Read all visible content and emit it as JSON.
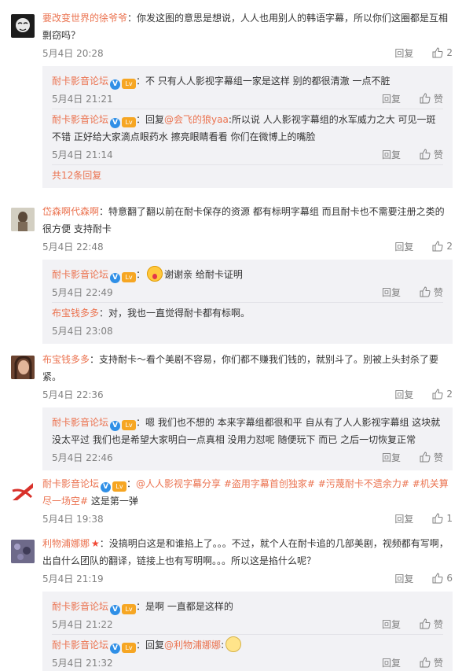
{
  "actions": {
    "reply_label": "回复",
    "like_label": "赞"
  },
  "threads": [
    {
      "user": "要改变世界的徐爷爷",
      "text": "你发这图的意思是想说，人人也用别人的韩语字幕，所以你们这圈都是互相剽窃吗？",
      "time": "5月4日 20:28",
      "likes": "2",
      "avatar_color": "#1c1c1c",
      "replies": [
        {
          "user": "耐卡影音论坛",
          "text": "不 只有人人影视字幕组一家是这样 别的都很清澈 一点不脏",
          "time": "5月4日 21:21"
        },
        {
          "user": "耐卡影音论坛",
          "prefix": "回复",
          "mention": "@会飞的狼yaa",
          "text": "所以说 人人影视字幕组的水军威力之大 可见一斑 不错 正好给大家滴点眼药水 擦亮眼睛看看 你们在微博上的嘴脸",
          "time": "5月4日 21:14"
        }
      ],
      "more": "共12条回复"
    },
    {
      "user": "岱森啊代森啊",
      "text": "特意翻了翻以前在耐卡保存的资源 都有标明字幕组 而且耐卡也不需要注册之类的很方便 支持耐卡",
      "time": "5月4日 22:48",
      "likes": "2",
      "avatar_color": "#b9b6a8",
      "replies": [
        {
          "user": "耐卡影音论坛",
          "text": "谢谢亲 给耐卡证明",
          "time": "5月4日 22:49"
        },
        {
          "user": "布宝钱多多",
          "text": "对，我也一直觉得耐卡都有标啊。",
          "time": "5月4日 23:08"
        }
      ]
    },
    {
      "user": "布宝钱多多",
      "text": "支持耐卡～看个美剧不容易，你们都不赚我们钱的，就别斗了。别被上头封杀了要紧。",
      "time": "5月4日 22:36",
      "likes": "2",
      "avatar_color": "#8a5a3c",
      "replies": [
        {
          "user": "耐卡影音论坛",
          "text": "嗯 我们也不想的 本来字幕组都很和平 自从有了人人影视字幕组 这块就没太平过 我们也是希望大家明白一点真相 没用力怼呢 随便玩下 而已 之后一切恢复正常",
          "time": "5月4日 22:46"
        }
      ]
    },
    {
      "user": "耐卡影音论坛",
      "text_parts": [
        "@人人影视字幕分享",
        " #盗用字幕首创独家#",
        " #污蔑耐卡不遗余力#",
        " #机关算尽一场空#",
        " 这是第一弹"
      ],
      "time": "5月4日 19:38",
      "likes": "1",
      "avatar_color": "#d8312a"
    },
    {
      "user": "利物浦娜娜",
      "text": "没搞明白这是和谁掐上了。。。不过，就个人在耐卡追的几部美剧，视频都有写啊，出自什么团队的翻译，链接上也有写明啊。。。所以这是掐什么呢？",
      "time": "5月4日 21:19",
      "likes": "6",
      "avatar_color": "#5a5a7a",
      "replies": [
        {
          "user": "耐卡影音论坛",
          "text": "是啊 一直都是这样的",
          "time": "5月4日 21:22"
        },
        {
          "user": "耐卡影音论坛",
          "prefix": "回复",
          "mention": "@利物浦娜娜",
          "text": ":",
          "time": "5月4日 21:32"
        }
      ]
    }
  ],
  "colors": {
    "username": "#eb7350",
    "reply_bg": "#f2f2f5",
    "verified": "#2f8fe6"
  }
}
